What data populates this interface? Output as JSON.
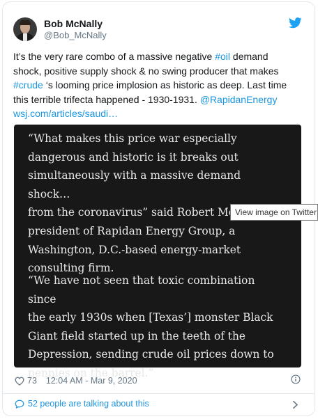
{
  "author": {
    "name": "Bob McNally",
    "handle": "@Bob_McNally"
  },
  "tweet": {
    "lines": [
      [
        {
          "t": "It’s the very rare combo of a massive negative ",
          "hl": false
        },
        {
          "t": "#oil",
          "hl": true
        },
        {
          "t": " demand",
          "hl": false
        }
      ],
      [
        {
          "t": "shock, positive supply shock & no swing producer that makes",
          "hl": false
        }
      ],
      [
        {
          "t": "#crude",
          "hl": true
        },
        {
          "t": " ‘s looming price implosion as historic as deep.   Last time",
          "hl": false
        }
      ],
      [
        {
          "t": "this terrible trifecta happened - 1930-1931. ",
          "hl": false
        },
        {
          "t": "@RapidanEnergy",
          "hl": true
        }
      ],
      [
        {
          "t": "wsj.com/articles/saudi…",
          "hl": true
        }
      ]
    ]
  },
  "image": {
    "paragraph1": "“What makes this price war especially\ndangerous and historic is it breaks out\nsimultaneously with a massive demand shock…\nfrom the coronavirus” said Robert McNally,\npresident of Rapidan Energy Group, a\nWashington, D.C.-based energy-market\nconsulting firm.",
    "paragraph2": "“We have not seen that toxic combination since\nthe early 1930s when [Texas’] monster Black\nGiant field started up in the teeth of the\nDepression, sending crude oil prices down to\npennies on the barrel.”",
    "tooltip": "View image on Twitter"
  },
  "meta": {
    "likes": "73",
    "timestamp": "12:04 AM - Mar 9, 2020"
  },
  "footer": {
    "talking": "52 people are talking about this"
  },
  "colors": {
    "accent": "#1b95e0",
    "text": "#14171a",
    "muted": "#657786",
    "image_bg": "#181818"
  },
  "icons": [
    "twitter-bird-icon",
    "heart-icon",
    "info-icon",
    "comment-bubble-icon",
    "chevron-right-icon"
  ]
}
